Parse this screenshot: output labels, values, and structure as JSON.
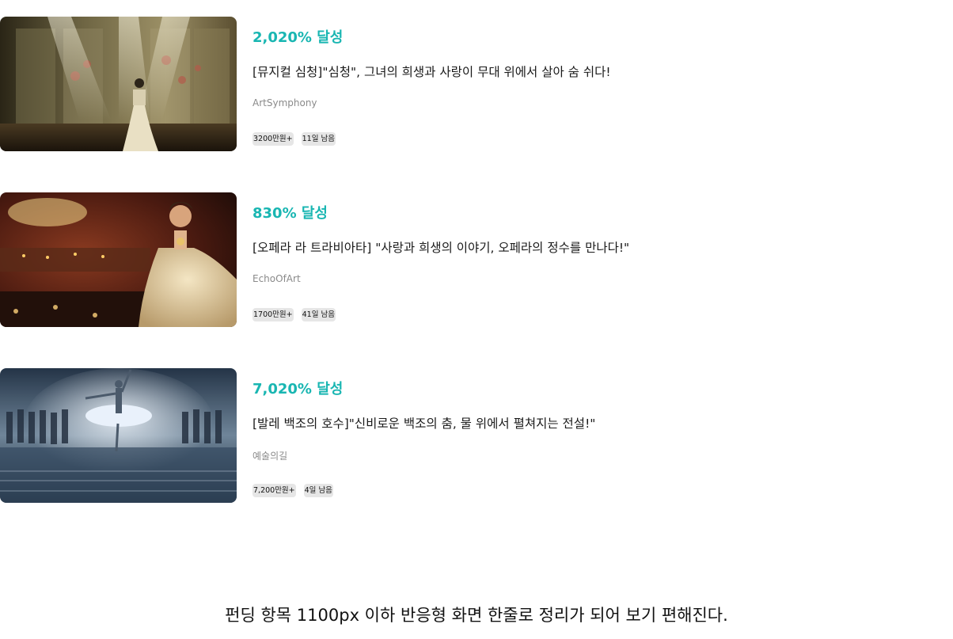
{
  "projects": [
    {
      "rate": "2,020% 달성",
      "title": "[뮤지컬 심청]\"심청\", 그녀의 희생과 사랑이 무대 위에서 살아 숨 쉬다!",
      "creator": "ArtSymphony",
      "amount": "3200만원+",
      "remaining": "11일 남음"
    },
    {
      "rate": "830% 달성",
      "title": "[오페라 라 트라비아타] \"사랑과 희생의 이야기, 오페라의 정수를 만나다!\"",
      "creator": "EchoOfArt",
      "amount": "1700만원+",
      "remaining": "41일 남음"
    },
    {
      "rate": "7,020% 달성",
      "title": "[발레 백조의 호수]\"신비로운 백조의 춤, 물 위에서 펼쳐지는 전설!\"",
      "creator": "예술의길",
      "amount": "7,200만원+",
      "remaining": "4일 남음"
    }
  ],
  "caption": "펀딩 항목 1100px 이하 반응형 화면 한줄로 정리가 되어 보기 편해진다.",
  "colors": {
    "accent": "#19b6b2",
    "tag_bg": "#e6e6e6",
    "muted_text": "#8a8a8a"
  }
}
